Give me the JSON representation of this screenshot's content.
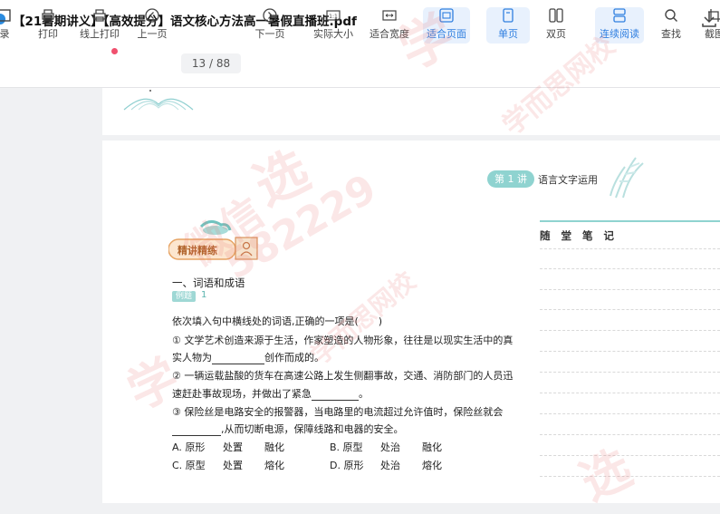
{
  "window": {
    "title": "【21暑期讲义】【高效提分】语文核心方法高一暑假直播班.pdf",
    "download_icon": "download-icon"
  },
  "toolbar": {
    "items": [
      {
        "label": "录",
        "icon": "directory-icon"
      },
      {
        "label": "打印",
        "icon": "print-icon"
      },
      {
        "label": "线上打印",
        "icon": "online-print-icon"
      },
      {
        "label": "上一页",
        "icon": "prev-page-icon"
      },
      {
        "label": "下一页",
        "icon": "next-page-icon"
      },
      {
        "label": "实际大小",
        "icon": "actual-size-icon"
      },
      {
        "label": "适合宽度",
        "icon": "fit-width-icon"
      },
      {
        "label": "适合页面",
        "icon": "fit-page-icon"
      },
      {
        "label": "单页",
        "icon": "single-page-icon"
      },
      {
        "label": "双页",
        "icon": "double-page-icon"
      },
      {
        "label": "连续阅读",
        "icon": "continuous-icon"
      },
      {
        "label": "查找",
        "icon": "search-icon"
      },
      {
        "label": "截图",
        "icon": "screenshot-icon"
      }
    ],
    "page_indicator": "13 / 88",
    "active_items": [
      "适合页面",
      "单页",
      "连续阅读"
    ],
    "accent": "#2f7fe0",
    "badge_color": "#f0506e"
  },
  "document": {
    "lesson_badge": "第 1 讲",
    "lesson_title": "语言文字运用",
    "notes_title": "随堂笔记",
    "section_badge": "精讲精练",
    "heading": "一、词语和成语",
    "example_label": "例题",
    "example_number": "1",
    "question_stem": "依次填入句中横线处的词语,正确的一项是(　　)",
    "sentence1_a": "① 文学艺术创造来源于生活，作家塑造的人物形象，往往是以现实生活中的真",
    "sentence1_b1": "实人物为",
    "sentence1_b2": "创作而成的。",
    "sentence2_a": "② 一辆运载盐酸的货车在高速公路上发生侧翻事故，交通、消防部门的人员迅",
    "sentence2_b1": "速赶赴事故现场，并做出了紧急",
    "sentence2_b2": "。",
    "sentence3_a": "③ 保险丝是电路安全的报警器，当电路里的电流超过允许值时，保险丝就会",
    "sentence3_b": ",从而切断电源，保障线路和电器的安全。",
    "options": [
      {
        "key": "A. 原形",
        "w2": "处置",
        "w3": "融化"
      },
      {
        "key": "B. 原型",
        "w2": "处治",
        "w3": "融化"
      },
      {
        "key": "C. 原型",
        "w2": "处置",
        "w3": "熔化"
      },
      {
        "key": "D. 原形",
        "w2": "处治",
        "w3": "熔化"
      }
    ],
    "accent_teal": "#8fd3d0"
  },
  "watermarks": [
    "学",
    "选",
    "微信",
    "582229",
    "学而思网校",
    "学而思网校",
    "学",
    "选"
  ]
}
